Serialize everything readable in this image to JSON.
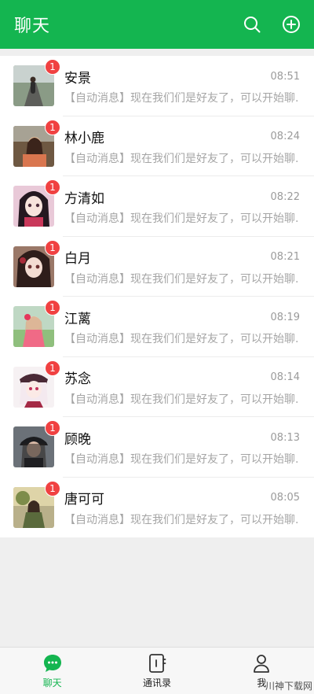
{
  "header": {
    "title": "聊天",
    "search_icon": "search-icon",
    "add_icon": "add-circle-icon"
  },
  "colors": {
    "accent": "#14b550",
    "badge": "#f04141"
  },
  "chats": [
    {
      "name": "安景",
      "time": "08:51",
      "message": "【自动消息】现在我们们是好友了，可以开始聊..",
      "unread": "1"
    },
    {
      "name": "林小鹿",
      "time": "08:24",
      "message": "【自动消息】现在我们们是好友了，可以开始聊..",
      "unread": "1"
    },
    {
      "name": "方清如",
      "time": "08:22",
      "message": "【自动消息】现在我们们是好友了，可以开始聊..",
      "unread": "1"
    },
    {
      "name": "白月",
      "time": "08:21",
      "message": "【自动消息】现在我们们是好友了，可以开始聊..",
      "unread": "1"
    },
    {
      "name": "江蓠",
      "time": "08:19",
      "message": "【自动消息】现在我们们是好友了，可以开始聊..",
      "unread": "1"
    },
    {
      "name": "苏念",
      "time": "08:14",
      "message": "【自动消息】现在我们们是好友了，可以开始聊..",
      "unread": "1"
    },
    {
      "name": "顾晚",
      "time": "08:13",
      "message": "【自动消息】现在我们们是好友了，可以开始聊..",
      "unread": "1"
    },
    {
      "name": "唐可可",
      "time": "08:05",
      "message": "【自动消息】现在我们们是好友了，可以开始聊..",
      "unread": "1"
    }
  ],
  "tabs": [
    {
      "label": "聊天",
      "icon": "chat-bubble-icon",
      "active": true
    },
    {
      "label": "通讯录",
      "icon": "contacts-book-icon",
      "active": false
    },
    {
      "label": "我",
      "icon": "person-icon",
      "active": false
    }
  ],
  "watermark": "川神下载网"
}
